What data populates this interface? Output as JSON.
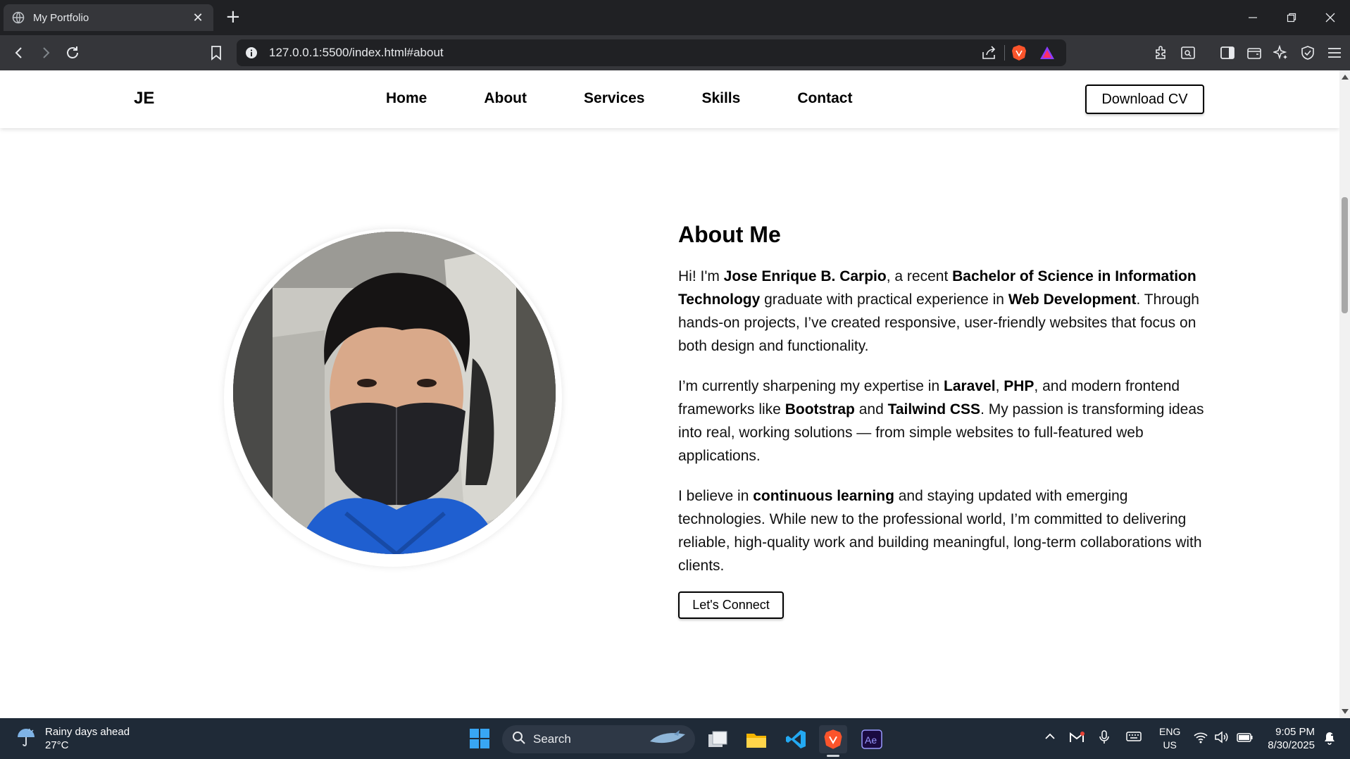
{
  "browser": {
    "tab_title": "My Portfolio",
    "url": "127.0.0.1:5500/index.html#about"
  },
  "nav": {
    "brand": "JE",
    "links": [
      "Home",
      "About",
      "Services",
      "Skills",
      "Contact"
    ],
    "cta": "Download CV"
  },
  "about": {
    "heading": "About Me",
    "p1": {
      "t1": "Hi! I'm ",
      "b1": "Jose Enrique B. Carpio",
      "t2": ", a recent ",
      "b2": "Bachelor of Science in Information Technology",
      "t3": " graduate with practical experience in ",
      "b3": "Web Development",
      "t4": ". Through hands-on projects, I’ve created responsive, user-friendly websites that focus on both design and functionality."
    },
    "p2": {
      "t1": "I’m currently sharpening my expertise in ",
      "b1": "Laravel",
      "t2": ", ",
      "b2": "PHP",
      "t3": ", and modern frontend frameworks like ",
      "b3": "Bootstrap",
      "t4": " and ",
      "b4": "Tailwind CSS",
      "t5": ". My passion is transforming ideas into real, working solutions — from simple websites to full-featured web applications."
    },
    "p3": {
      "t1": "I believe in ",
      "b1": "continuous learning",
      "t2": " and staying updated with emerging technologies. While new to the professional world, I’m committed to delivering reliable, high-quality work and building meaningful, long-term collaborations with clients."
    },
    "button": "Let's Connect"
  },
  "taskbar": {
    "weather_title": "Rainy days ahead",
    "weather_temp": "27°C",
    "search_label": "Search",
    "lang_top": "ENG",
    "lang_bottom": "US",
    "time": "9:05 PM",
    "date": "8/30/2025"
  },
  "colors": {
    "tabbar": "#202124",
    "toolbar": "#35363a",
    "taskbar": "#1f2a37",
    "accent_blue": "#38a6f4",
    "brave_orange": "#fb542b"
  },
  "icons": [
    "globe-icon",
    "close-icon",
    "plus-icon",
    "minimize-icon",
    "restore-icon",
    "window-close-icon",
    "back-icon",
    "forward-icon",
    "reload-icon",
    "bookmark-icon",
    "info-icon",
    "share-icon",
    "brave-shields-icon",
    "brave-rewards-icon",
    "extensions-icon",
    "screenshot-icon",
    "sidebar-icon",
    "wallet-icon",
    "leo-ai-icon",
    "vpn-icon",
    "menu-icon",
    "weather-icon",
    "windows-start-icon",
    "search-icon",
    "task-view-icon",
    "file-explorer-icon",
    "vscode-icon",
    "brave-app-icon",
    "after-effects-icon",
    "chevron-up-icon",
    "gmail-icon",
    "mic-icon",
    "keyboard-icon",
    "wifi-icon",
    "volume-icon",
    "battery-icon",
    "notification-icon"
  ]
}
